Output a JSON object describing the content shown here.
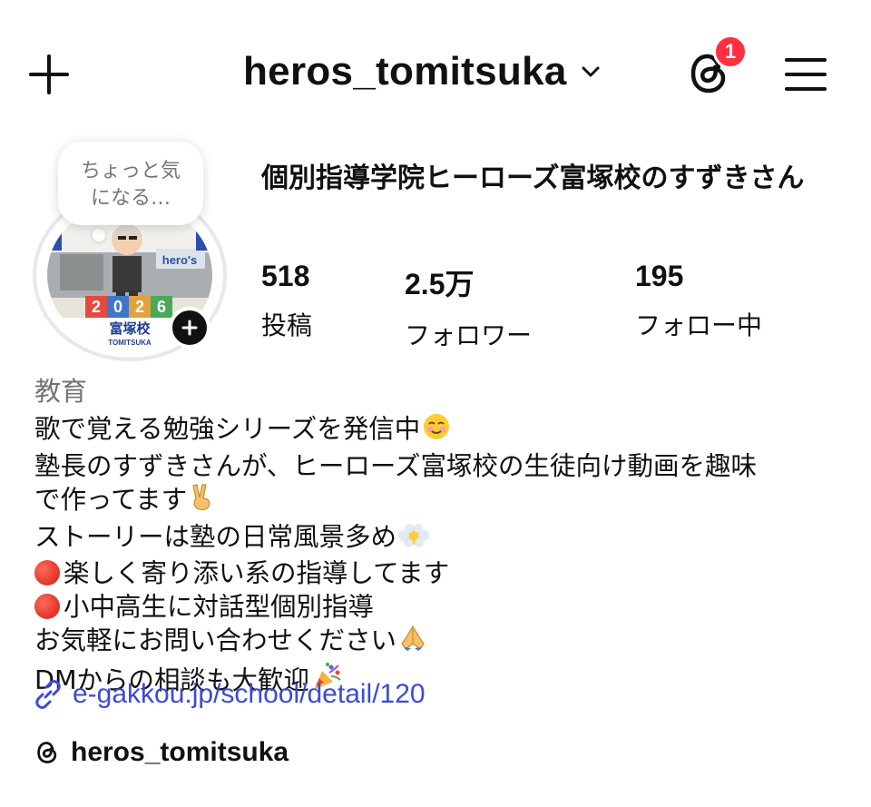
{
  "header": {
    "username": "heros_tomitsuka",
    "notification_count": "1",
    "icons": {
      "create": "plus-icon",
      "threads": "threads-icon",
      "dropdown": "chevron-down-icon",
      "menu": "hamburger-menu-icon"
    },
    "badge_color": "#ff3040"
  },
  "profile": {
    "note_text": "ちょっと気になる…",
    "avatar_texts": {
      "school": "富塚校",
      "school_romaji": "TOMITSUKA",
      "banner": "hero's",
      "blocks": [
        "2",
        "0",
        "2",
        "6"
      ]
    },
    "display_name": "個別指導学院ヒーローズ富塚校のすずきさん",
    "stats": {
      "posts": {
        "value": "518",
        "label": "投稿"
      },
      "followers": {
        "value": "2.5万",
        "label": "フォロワー"
      },
      "following": {
        "value": "195",
        "label": "フォロー中"
      }
    }
  },
  "bio": {
    "category": "教育",
    "lines": [
      "歌で覚える勉強シリーズを発信中",
      "塾長のすずきさんが、ヒーローズ富塚校の生徒向け動画を趣味",
      "で作ってます",
      "ストーリーは塾の日常風景多め",
      "楽しく寄り添い系の指導してます",
      "小中高生に対話型個別指導",
      "お気軽にお問い合わせください",
      "DMからの相談も大歓迎"
    ],
    "emojis": [
      "smiling-face",
      "victory-hand",
      "face-in-clouds",
      "red-circle",
      "red-circle",
      "folded-hands",
      "party-popper"
    ],
    "link": "e-gakkou.jp/school/detail/120",
    "link_color": "#3b4bd8",
    "threads_handle": "heros_tomitsuka"
  }
}
